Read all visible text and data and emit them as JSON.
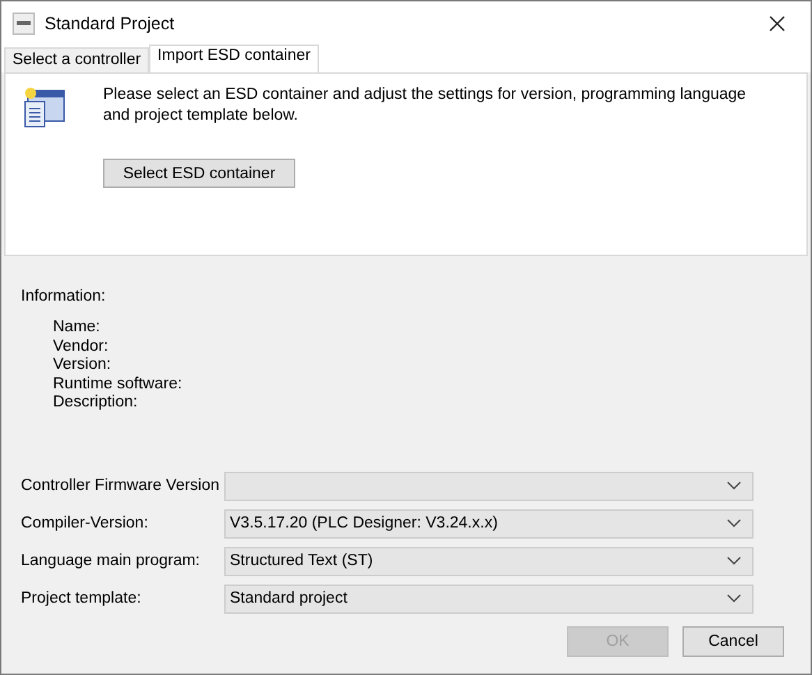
{
  "window": {
    "title": "Standard Project"
  },
  "tabs": [
    {
      "label": "Select a controller",
      "selected": false
    },
    {
      "label": "Import ESD container",
      "selected": true
    }
  ],
  "intro": {
    "text": "Please select an ESD container and adjust the settings for version, programming language and project template below.",
    "button": "Select ESD container"
  },
  "information": {
    "heading": "Information:",
    "fields": [
      "Name:",
      "Vendor:",
      "Version:",
      "Runtime software:",
      "Description:"
    ]
  },
  "settings": [
    {
      "label": "Controller Firmware Version"
    },
    {
      "label": "Compiler-Version:",
      "value": "V3.5.17.20 (PLC Designer: V3.24.x.x)"
    },
    {
      "label": "Language main program:",
      "value": "Structured Text (ST)"
    },
    {
      "label": "Project template:",
      "value": "Standard project"
    }
  ],
  "buttons": [
    {
      "label": "OK",
      "disabled": true
    },
    {
      "label": "Cancel",
      "disabled": false
    }
  ]
}
